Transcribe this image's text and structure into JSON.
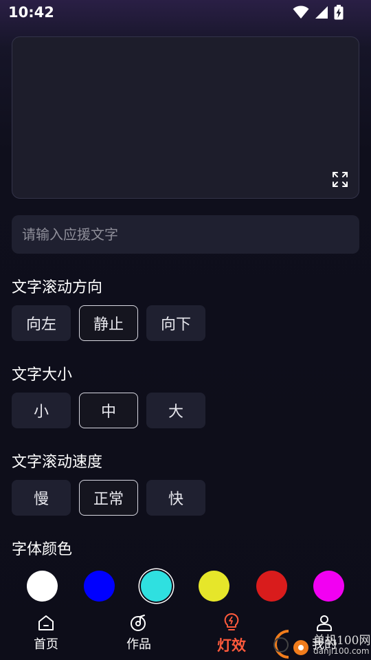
{
  "status_bar": {
    "time": "10:42"
  },
  "input": {
    "placeholder": "请输入应援文字",
    "value": ""
  },
  "sections": {
    "direction": {
      "title": "文字滚动方向",
      "options": [
        "向左",
        "静止",
        "向下"
      ],
      "selected": "静止"
    },
    "size": {
      "title": "文字大小",
      "options": [
        "小",
        "中",
        "大"
      ],
      "selected": "中"
    },
    "speed": {
      "title": "文字滚动速度",
      "options": [
        "慢",
        "正常",
        "快"
      ],
      "selected": "正常"
    },
    "color": {
      "title": "字体颜色",
      "swatches": [
        "#ffffff",
        "#0000ff",
        "#2fe0e0",
        "#e6e62a",
        "#d91c1c",
        "#f200f2"
      ],
      "selected": "#2fe0e0"
    }
  },
  "bottom_nav": {
    "items": [
      {
        "label": "首页",
        "icon": "home-icon"
      },
      {
        "label": "作品",
        "icon": "music-disc-icon"
      },
      {
        "label": "灯效",
        "icon": "bulb-icon",
        "active": true
      },
      {
        "label": "我的",
        "icon": "user-icon"
      }
    ],
    "active_color": "#ff5a3c"
  },
  "watermark": {
    "line1": "单机100网",
    "line2": "danji100.com"
  }
}
